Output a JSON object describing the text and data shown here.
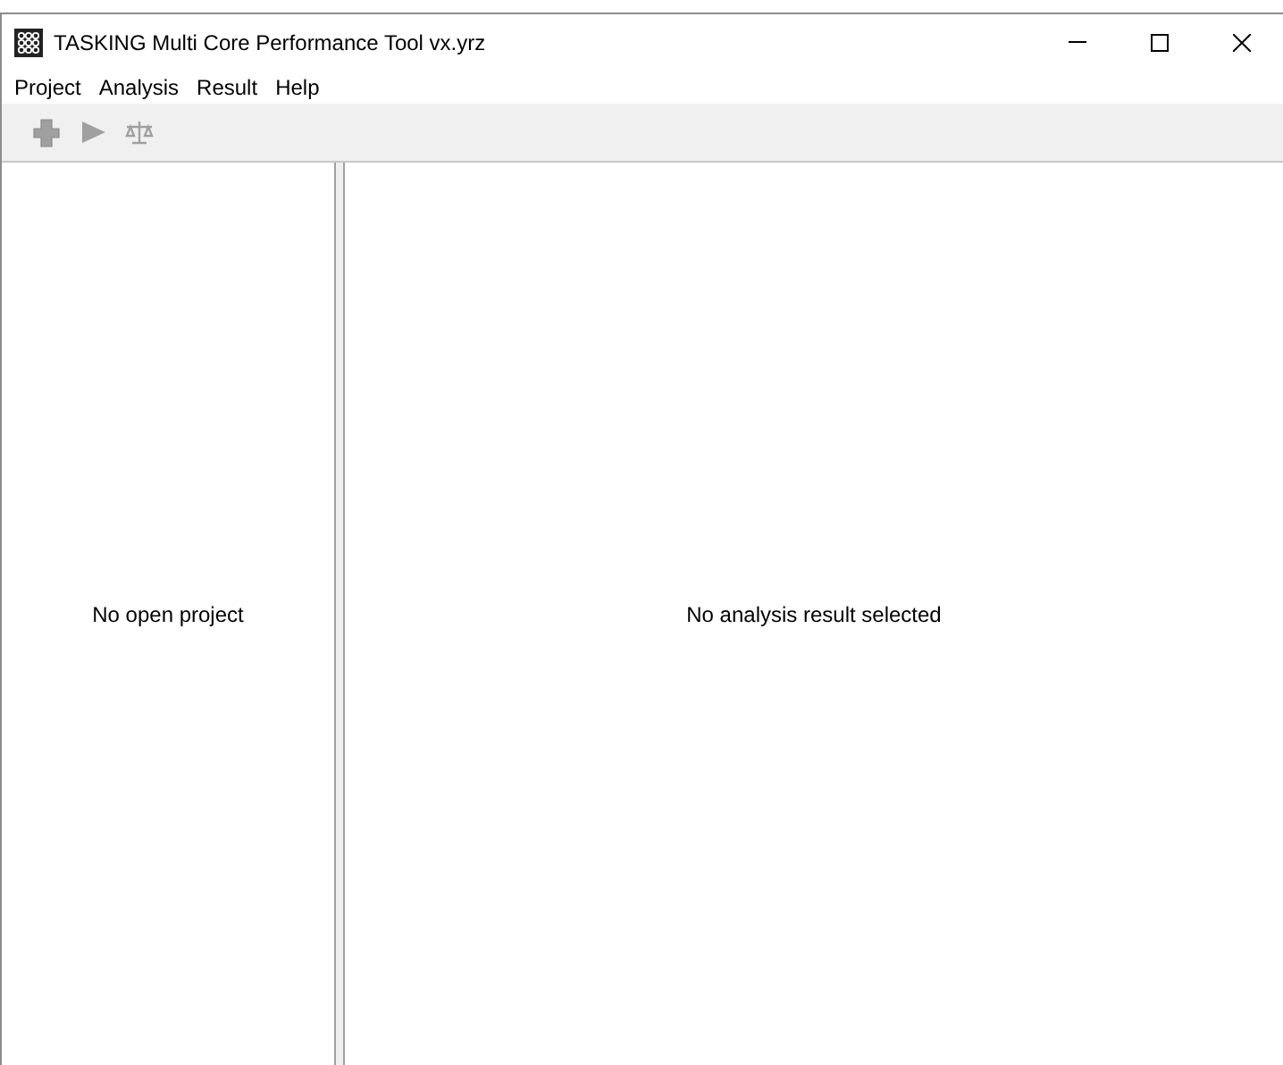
{
  "window": {
    "title": "TASKING Multi Core Performance Tool vx.yrz"
  },
  "menu": [
    "Project",
    "Analysis",
    "Result",
    "Help"
  ],
  "toolbar": [
    {
      "kind": "add",
      "disabled": true
    },
    {
      "kind": "run",
      "disabled": true
    },
    {
      "kind": "compare",
      "disabled": true
    }
  ],
  "project_panel": {
    "message": "No open project"
  },
  "result_panel": {
    "message": "No analysis result selected"
  }
}
